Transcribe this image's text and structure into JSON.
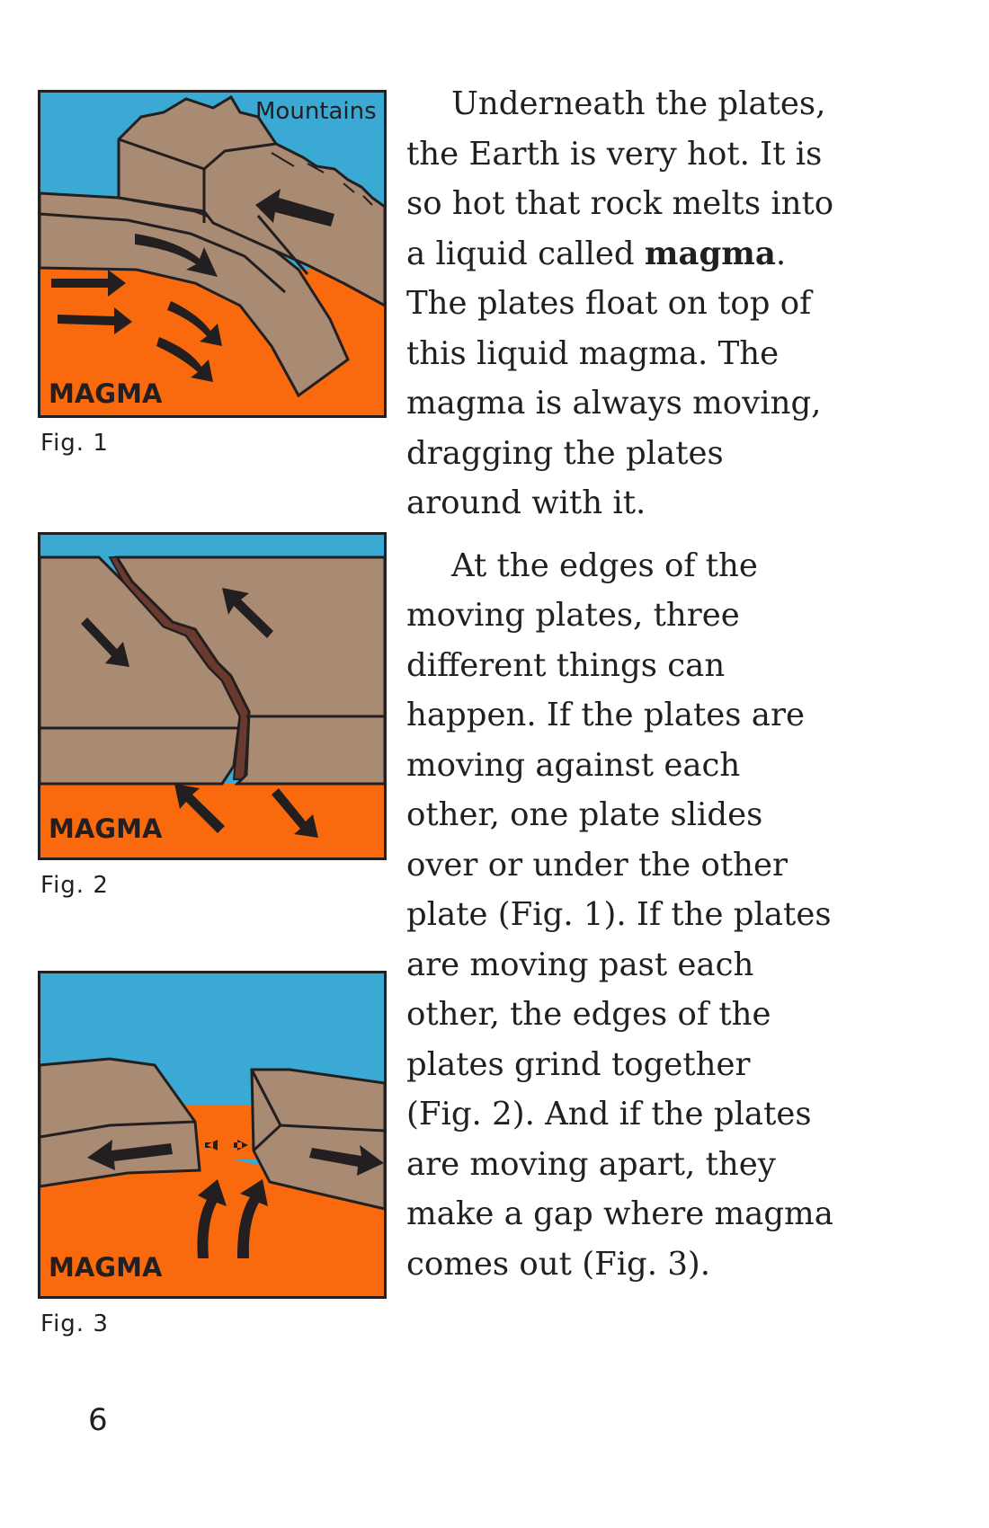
{
  "figures": [
    {
      "caption": "Fig. 1",
      "magma_label": "MAGMA",
      "top_label": "Mountains"
    },
    {
      "caption": "Fig. 2",
      "magma_label": "MAGMA"
    },
    {
      "caption": "Fig. 3",
      "magma_label": "MAGMA"
    }
  ],
  "paragraph1": {
    "before_bold": "Underneath the plates,\nthe Earth is very hot. It is\nso hot that rock melts into\na liquid called ",
    "bold": "magma",
    "after_bold": ".\nThe plates float on top of\nthis liquid magma. The\nmagma is always moving,\ndragging the plates\naround with it."
  },
  "paragraph2": "At the edges of the\nmoving plates, three\ndifferent things can\nhappen. If the plates are\nmoving against each\nother, one plate slides\nover or under the other\nplate (Fig. 1). If the plates\nare moving past each\nother, the edges of the\nplates grind together\n(Fig. 2). And if the plates\nare moving apart, they\nmake a gap where magma\ncomes out (Fig. 3).",
  "page_number": "6",
  "colors": {
    "sky": "#3aa9d3",
    "rock": "#a98a73",
    "magma": "#f86a0d",
    "fault": "#6b3a2f",
    "ink": "#231f20"
  }
}
